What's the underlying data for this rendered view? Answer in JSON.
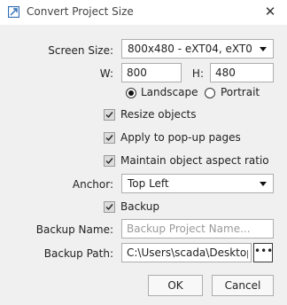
{
  "window": {
    "title": "Convert Project Size",
    "close_icon": "close-icon"
  },
  "screen_size": {
    "label": "Screen Size:",
    "value": "800x480 - eXT04, eXT0..."
  },
  "width": {
    "label": "W:",
    "value": "800"
  },
  "height": {
    "label": "H:",
    "value": "480"
  },
  "orientation": {
    "landscape_label": "Landscape",
    "portrait_label": "Portrait",
    "selected": "Landscape"
  },
  "options": {
    "resize_objects": {
      "label": "Resize objects",
      "checked": true
    },
    "apply_popups": {
      "label": "Apply to pop-up pages",
      "checked": true
    },
    "maintain_aspect": {
      "label": "Maintain object aspect ratio",
      "checked": true
    }
  },
  "anchor": {
    "label": "Anchor:",
    "value": "Top Left"
  },
  "backup": {
    "label": "Backup",
    "checked": true
  },
  "backup_name": {
    "label": "Backup Name:",
    "value": "",
    "placeholder": "Backup Project Name..."
  },
  "backup_path": {
    "label": "Backup Path:",
    "value": "C:\\Users\\scada\\Desktop\\",
    "browse_label": "•••"
  },
  "buttons": {
    "ok": "OK",
    "cancel": "Cancel"
  },
  "colors": {
    "title_bg": "#ffffff",
    "dialog_bg": "#f0f0f0",
    "icon_blue": "#2f6db5"
  }
}
